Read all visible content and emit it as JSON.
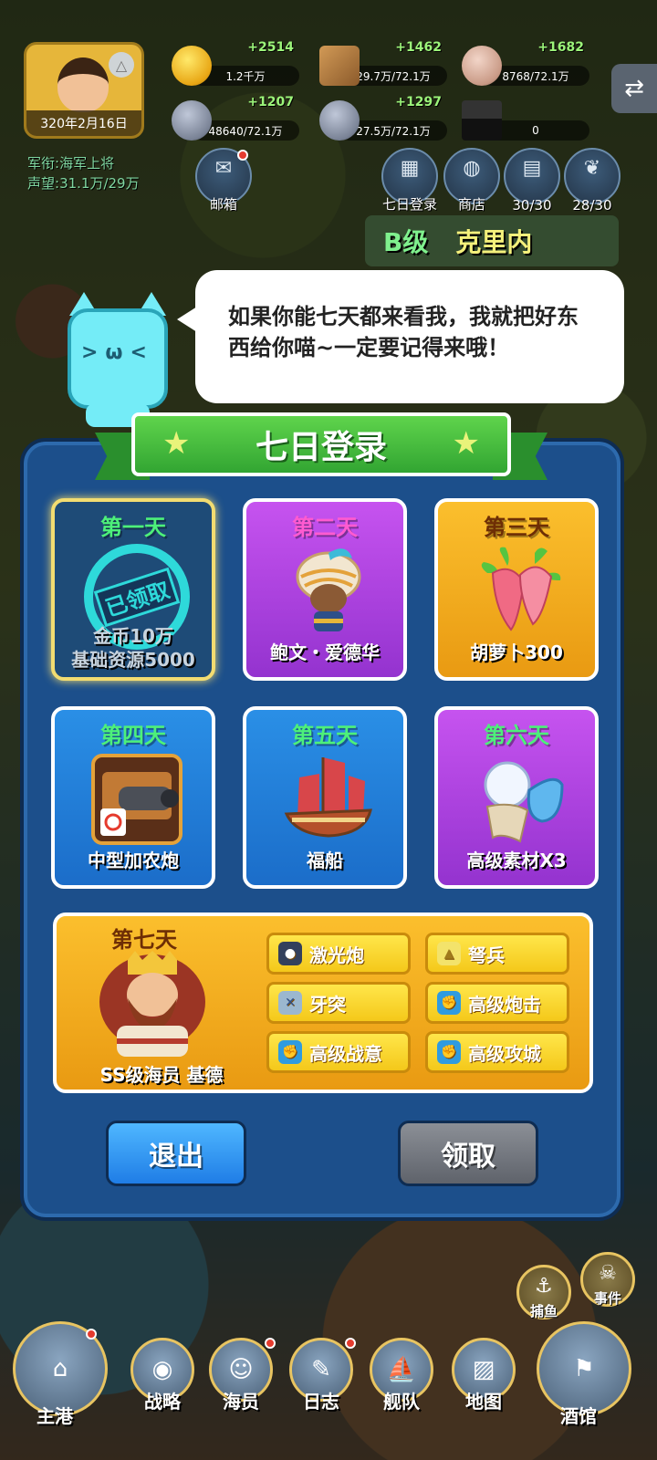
{
  "player": {
    "date": "320年2月16日",
    "rank_label": "军衔:",
    "rank_value": "海军上将",
    "fame_label": "声望:",
    "fame_value": "31.1万/29万"
  },
  "resources": [
    {
      "gain": "+2514",
      "amount": "1.2千万"
    },
    {
      "gain": "+1462",
      "amount": "29.7万/72.1万"
    },
    {
      "gain": "+1682",
      "amount": "8768/72.1万"
    },
    {
      "gain": "+1207",
      "amount": "48640/72.1万"
    },
    {
      "gain": "+1297",
      "amount": "27.5万/72.1万"
    },
    {
      "gain": "",
      "amount": "0"
    }
  ],
  "hud_icons": [
    {
      "label": "邮箱",
      "icon": "mail-icon",
      "glyph": "✉"
    },
    {
      "label": "七日登录",
      "icon": "calendar-icon",
      "glyph": "▦"
    },
    {
      "label": "商店",
      "icon": "bag-icon",
      "glyph": "◍"
    },
    {
      "label": "30/30",
      "icon": "book-icon",
      "glyph": "▤"
    },
    {
      "label": "28/30",
      "icon": "scroll-icon",
      "glyph": "❦"
    }
  ],
  "bg_banner": {
    "grade": "B级",
    "name": "克里内"
  },
  "speech": "如果你能七天都来看我，我就把好东西给你喵~一定要记得来哦！",
  "dialog": {
    "title": "七日登录",
    "days": [
      {
        "title": "第一天",
        "name": "金币10万\n基础资源5000",
        "stamp": "已领取"
      },
      {
        "title": "第二天",
        "name": "鲍文・爱德华"
      },
      {
        "title": "第三天",
        "name": "胡萝卜300"
      },
      {
        "title": "第四天",
        "name": "中型加农炮"
      },
      {
        "title": "第五天",
        "name": "福船"
      },
      {
        "title": "第六天",
        "name": "高级素材X3"
      }
    ],
    "day7": {
      "title": "第七天",
      "name": "SS级海员 基德",
      "rewards": [
        "激光炮",
        "弩兵",
        "牙突",
        "高级炮击",
        "高级战意",
        "高级攻城"
      ]
    },
    "exit_label": "退出",
    "claim_label": "领取"
  },
  "side_buttons": [
    {
      "label": "捕鱼",
      "icon": "fishing-icon"
    },
    {
      "label": "事件",
      "icon": "event-icon"
    }
  ],
  "nav": [
    {
      "label": "主港",
      "icon": "harbor-icon"
    },
    {
      "label": "战略",
      "icon": "globe-icon"
    },
    {
      "label": "海员",
      "icon": "crew-icon"
    },
    {
      "label": "日志",
      "icon": "log-icon"
    },
    {
      "label": "舰队",
      "icon": "fleet-icon"
    },
    {
      "label": "地图",
      "icon": "map-icon"
    },
    {
      "label": "酒馆",
      "icon": "tavern-icon"
    }
  ],
  "colors": {
    "panel": "#1c4f8b",
    "ribbon": "#32a532",
    "claimed_ring": "#2ed9da",
    "gold_card": "#f4b020"
  }
}
